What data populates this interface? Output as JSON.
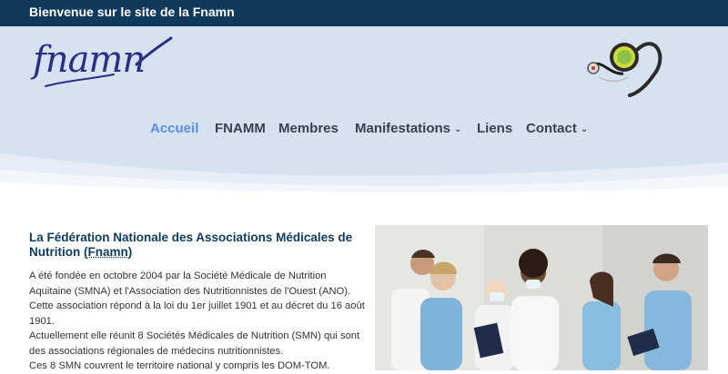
{
  "topbar": {
    "text": "Bienvenue sur le site de la Fnamn"
  },
  "logo": {
    "text": "fnamn"
  },
  "nav": {
    "items": [
      {
        "label": "Accueil",
        "active": true,
        "dropdown": false
      },
      {
        "label": "FNAMM",
        "active": false,
        "dropdown": false
      },
      {
        "label": "Membres",
        "active": false,
        "dropdown": false
      },
      {
        "label": "Manifestations",
        "active": false,
        "dropdown": true
      },
      {
        "label": "Liens",
        "active": false,
        "dropdown": false
      },
      {
        "label": "Contact",
        "active": false,
        "dropdown": true
      }
    ]
  },
  "main": {
    "title": "La Fédération Nationale des Associations Médicales de Nutrition",
    "title_acronym": "(Fnamn)",
    "paragraphs": [
      "A été fondée en octobre 2004 par la Société Médicale de Nutrition Aquitaine (SMNA) et l'Association des Nutritionnistes de l'Ouest (ANO).",
      "Cette association répond à la loi du 1er juillet 1901 et au décret du 16 août 1901.",
      "Actuellement elle réunit 8 Sociétés Médicales de Nutrition (SMN) qui sont des associations régionales de médecins nutritionnistes.",
      "Ces 8 SMN couvrent le territoire national y compris les DOM-TOM."
    ]
  },
  "colors": {
    "topbar_bg": "#0f3a5c",
    "header_bg": "#d6e2f0",
    "nav_active": "#5b8de0",
    "nav_text": "#3c3f4a",
    "title": "#0f3a5c"
  }
}
